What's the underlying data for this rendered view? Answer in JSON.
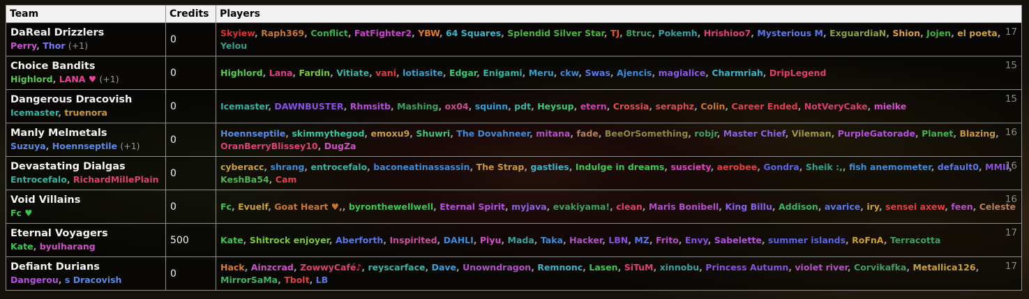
{
  "headers": {
    "team": "Team",
    "credits": "Credits",
    "players": "Players"
  },
  "teams": [
    {
      "name": "DaReal Drizzlers",
      "captains": [
        {
          "name": "Perry",
          "color": "#d050d8"
        },
        {
          "name": "Thor",
          "color": "#7a7aff"
        }
      ],
      "extra": "(+1)",
      "credits": "0",
      "count": "17",
      "players": [
        {
          "name": "Skyiew",
          "color": "#e03030"
        },
        {
          "name": "Raph369",
          "color": "#c87832"
        },
        {
          "name": "Conflict",
          "color": "#32b450"
        },
        {
          "name": "FatFighter2",
          "color": "#d040d0"
        },
        {
          "name": "YBW",
          "color": "#e87820"
        },
        {
          "name": "64 Squares",
          "color": "#3cb4c8"
        },
        {
          "name": "Splendid Silver Star",
          "color": "#4ab43c"
        },
        {
          "name": "TJ",
          "color": "#e05a28"
        },
        {
          "name": "8truc",
          "color": "#3ca064"
        },
        {
          "name": "Pokemh",
          "color": "#32a0a0"
        },
        {
          "name": "Hrishioo7",
          "color": "#e0407a"
        },
        {
          "name": "Mysterious M",
          "color": "#5a78e8"
        },
        {
          "name": "ExguardiaN",
          "color": "#8aa03c"
        },
        {
          "name": "Shion",
          "color": "#e0a040"
        },
        {
          "name": "Jojen",
          "color": "#3cb43c"
        },
        {
          "name": "el poeta",
          "color": "#c8a03c"
        },
        {
          "name": "Yelou",
          "color": "#32a08c"
        }
      ]
    },
    {
      "name": "Choice Bandits",
      "captains": [
        {
          "name": "Highlord",
          "color": "#5ac850"
        },
        {
          "name": "LANA ♥",
          "color": "#f040a0"
        }
      ],
      "extra": "(+1)",
      "credits": "0",
      "count": "15",
      "players": [
        {
          "name": "Highlord",
          "color": "#5ac850"
        },
        {
          "name": "Lana",
          "color": "#e0408a"
        },
        {
          "name": "Fardin",
          "color": "#78c83c"
        },
        {
          "name": "Vitiate",
          "color": "#3cb4a0"
        },
        {
          "name": "vani",
          "color": "#e04040"
        },
        {
          "name": "lotiasite",
          "color": "#3ca0c8"
        },
        {
          "name": "Edgar",
          "color": "#3cc878"
        },
        {
          "name": "Enigami",
          "color": "#32b4a0"
        },
        {
          "name": "Meru",
          "color": "#32a0c8"
        },
        {
          "name": "ckw",
          "color": "#3c8cd8"
        },
        {
          "name": "Swas",
          "color": "#5a78e8"
        },
        {
          "name": "Ajencis",
          "color": "#3c8cd8"
        },
        {
          "name": "magialice",
          "color": "#8a5ae8"
        },
        {
          "name": "Charmriah",
          "color": "#3cb4c8"
        },
        {
          "name": "DripLegend",
          "color": "#e04070"
        }
      ]
    },
    {
      "name": "Dangerous Dracovish",
      "captains": [
        {
          "name": "Icemaster",
          "color": "#32b4a0"
        },
        {
          "name": "truenora",
          "color": "#c8963c"
        }
      ],
      "extra": "",
      "credits": "0",
      "count": "15",
      "players": [
        {
          "name": "Icemaster",
          "color": "#32b4a0"
        },
        {
          "name": "DAWNBUSTER",
          "color": "#8a50e0"
        },
        {
          "name": "Rhmsitb",
          "color": "#b450d8"
        },
        {
          "name": "Mashing",
          "color": "#3ca064"
        },
        {
          "name": "ox04",
          "color": "#c85090"
        },
        {
          "name": "squinn",
          "color": "#32a0d8"
        },
        {
          "name": "pdt",
          "color": "#3cb4a0"
        },
        {
          "name": "Heysup",
          "color": "#3cc878"
        },
        {
          "name": "etern",
          "color": "#d040b4"
        },
        {
          "name": "Crossia",
          "color": "#e05050"
        },
        {
          "name": "seraphz",
          "color": "#d05050"
        },
        {
          "name": "Colin",
          "color": "#c87832"
        },
        {
          "name": "Career Ended",
          "color": "#e04050"
        },
        {
          "name": "NotVeryCake",
          "color": "#d04070"
        },
        {
          "name": "mielke",
          "color": "#d050c8"
        }
      ]
    },
    {
      "name": "Manly Melmetals",
      "captains": [
        {
          "name": "Suzuya",
          "color": "#5a8ae8"
        },
        {
          "name": "Hoennseptile",
          "color": "#5a8ae8"
        }
      ],
      "extra": "(+1)",
      "credits": "0",
      "count": "16",
      "players": [
        {
          "name": "Hoennseptile",
          "color": "#5a8ae8"
        },
        {
          "name": "skimmythegod",
          "color": "#32c8a0"
        },
        {
          "name": "emoxu9",
          "color": "#c8a03c"
        },
        {
          "name": "Shuwri",
          "color": "#3cc878"
        },
        {
          "name": "The Dovahneer",
          "color": "#3c8cd8"
        },
        {
          "name": "mitana",
          "color": "#b450c8"
        },
        {
          "name": "fade",
          "color": "#b4825a"
        },
        {
          "name": "BeeOrSomething",
          "color": "#8a8a3c"
        },
        {
          "name": "robjr",
          "color": "#3ca064"
        },
        {
          "name": "Master Chief",
          "color": "#8a64e0"
        },
        {
          "name": "Vileman",
          "color": "#a0963c"
        },
        {
          "name": "PurpleGatorade",
          "color": "#b450e0"
        },
        {
          "name": "Planet",
          "color": "#3cb450"
        },
        {
          "name": "Blazing",
          "color": "#c8963c"
        },
        {
          "name": "OranBerryBlissey10",
          "color": "#e04078"
        },
        {
          "name": "DugZa",
          "color": "#d050c8"
        }
      ]
    },
    {
      "name": "Devastating Dialgas",
      "captains": [
        {
          "name": "Entrocefalo",
          "color": "#32b4a0"
        },
        {
          "name": "RichardMillePlain",
          "color": "#e04070"
        }
      ],
      "extra": "",
      "credits": "0",
      "count": "16",
      "players": [
        {
          "name": "cyberacc",
          "color": "#c8a03c"
        },
        {
          "name": "shrang",
          "color": "#3c8cd8"
        },
        {
          "name": "entrocefalo",
          "color": "#32b4a0"
        },
        {
          "name": "baconeatinassassin",
          "color": "#3c8cd8"
        },
        {
          "name": "The Strap",
          "color": "#c8963c"
        },
        {
          "name": "gastlies",
          "color": "#3cb4c8"
        },
        {
          "name": "Indulge in dreams",
          "color": "#3cc850"
        },
        {
          "name": "susciety",
          "color": "#e040c8"
        },
        {
          "name": "aerobee",
          "color": "#e04040"
        },
        {
          "name": "Gondra",
          "color": "#5a64e8"
        },
        {
          "name": "Sheik :,",
          "color": "#32a08c"
        },
        {
          "name": "fish anemometer",
          "color": "#3c8cd8"
        },
        {
          "name": "default0",
          "color": "#5a78e8"
        },
        {
          "name": "MMII",
          "color": "#8a50e0"
        },
        {
          "name": "KeshBa54",
          "color": "#50b450"
        },
        {
          "name": "Cam",
          "color": "#e04050"
        }
      ]
    },
    {
      "name": "Void Villains",
      "captains": [
        {
          "name": "Fc ♥",
          "color": "#3cc850"
        }
      ],
      "extra": "",
      "credits": "0",
      "count": "16",
      "players": [
        {
          "name": "Fc",
          "color": "#3cc850"
        },
        {
          "name": "Evuelf",
          "color": "#c8a03c"
        },
        {
          "name": "Goat Heart ♥,",
          "color": "#c87832"
        },
        {
          "name": "byronthewellwell",
          "color": "#3cc850"
        },
        {
          "name": "Eternal Spirit",
          "color": "#b450e0"
        },
        {
          "name": "myjava",
          "color": "#8a64e0"
        },
        {
          "name": "evakiyama!",
          "color": "#3ca064"
        },
        {
          "name": "clean",
          "color": "#e04070"
        },
        {
          "name": "Maris Bonibell",
          "color": "#b450c8"
        },
        {
          "name": "King Billu",
          "color": "#8a64e0"
        },
        {
          "name": "Addison",
          "color": "#3cb464"
        },
        {
          "name": "avarice",
          "color": "#5a78e8"
        },
        {
          "name": "iry",
          "color": "#c8a03c"
        },
        {
          "name": "sensei axew",
          "color": "#e04040"
        },
        {
          "name": "feen",
          "color": "#b450c8"
        },
        {
          "name": "Celeste",
          "color": "#b4825a"
        }
      ]
    },
    {
      "name": "Eternal Voyagers",
      "captains": [
        {
          "name": "Kate",
          "color": "#3cc850"
        },
        {
          "name": "byulharang",
          "color": "#d050c8"
        }
      ],
      "extra": "",
      "credits": "500",
      "count": "17",
      "players": [
        {
          "name": "Kate",
          "color": "#3cc850"
        },
        {
          "name": "Shitrock enjoyer",
          "color": "#78c83c"
        },
        {
          "name": "Aberforth",
          "color": "#5a78e8"
        },
        {
          "name": "Inspirited",
          "color": "#c850a0"
        },
        {
          "name": "DAHLI",
          "color": "#3c8cd8"
        },
        {
          "name": "Piyu",
          "color": "#d050c8"
        },
        {
          "name": "Mada",
          "color": "#3ca0a0"
        },
        {
          "name": "Taka",
          "color": "#3c8cd8"
        },
        {
          "name": "Hacker",
          "color": "#b450c8"
        },
        {
          "name": "LBN",
          "color": "#8a50e0"
        },
        {
          "name": "MZ",
          "color": "#5a78e8"
        },
        {
          "name": "Frito",
          "color": "#b450c8"
        },
        {
          "name": "Envy",
          "color": "#8a50e0"
        },
        {
          "name": "Sabelette",
          "color": "#b450e0"
        },
        {
          "name": "summer islands",
          "color": "#5a64e8"
        },
        {
          "name": "RoFnA",
          "color": "#c8a03c"
        },
        {
          "name": "Terracotta",
          "color": "#3ca064"
        }
      ]
    },
    {
      "name": "Defiant Durians",
      "captains": [
        {
          "name": "Dangerou",
          "color": "#b450e0"
        },
        {
          "name": "s Dracovish",
          "color": "#5a8ae8"
        }
      ],
      "extra": "",
      "credits": "0",
      "count": "17",
      "players": [
        {
          "name": "Hack",
          "color": "#e07832"
        },
        {
          "name": "Ainzcrad",
          "color": "#d050c8"
        },
        {
          "name": "ZowwyCafé♪",
          "color": "#e04070"
        },
        {
          "name": "reyscarface",
          "color": "#3cb4a0"
        },
        {
          "name": "Dave",
          "color": "#3ca0d8"
        },
        {
          "name": "Unowndragon",
          "color": "#b450c8"
        },
        {
          "name": "Remnonc",
          "color": "#3cb4c8"
        },
        {
          "name": "Lasen",
          "color": "#3cc850"
        },
        {
          "name": "SiTuM",
          "color": "#e04070"
        },
        {
          "name": "xinnobu",
          "color": "#3ca0a0"
        },
        {
          "name": "Princess Autumn",
          "color": "#8a50e0"
        },
        {
          "name": "violet river",
          "color": "#b450c8"
        },
        {
          "name": "Corvikafka",
          "color": "#3ca064"
        },
        {
          "name": "Metallica126",
          "color": "#c8a03c"
        },
        {
          "name": "MirrorSaMa",
          "color": "#3cb464"
        },
        {
          "name": "Tbolt",
          "color": "#e04040"
        },
        {
          "name": "LB",
          "color": "#5a78e8"
        }
      ]
    }
  ]
}
